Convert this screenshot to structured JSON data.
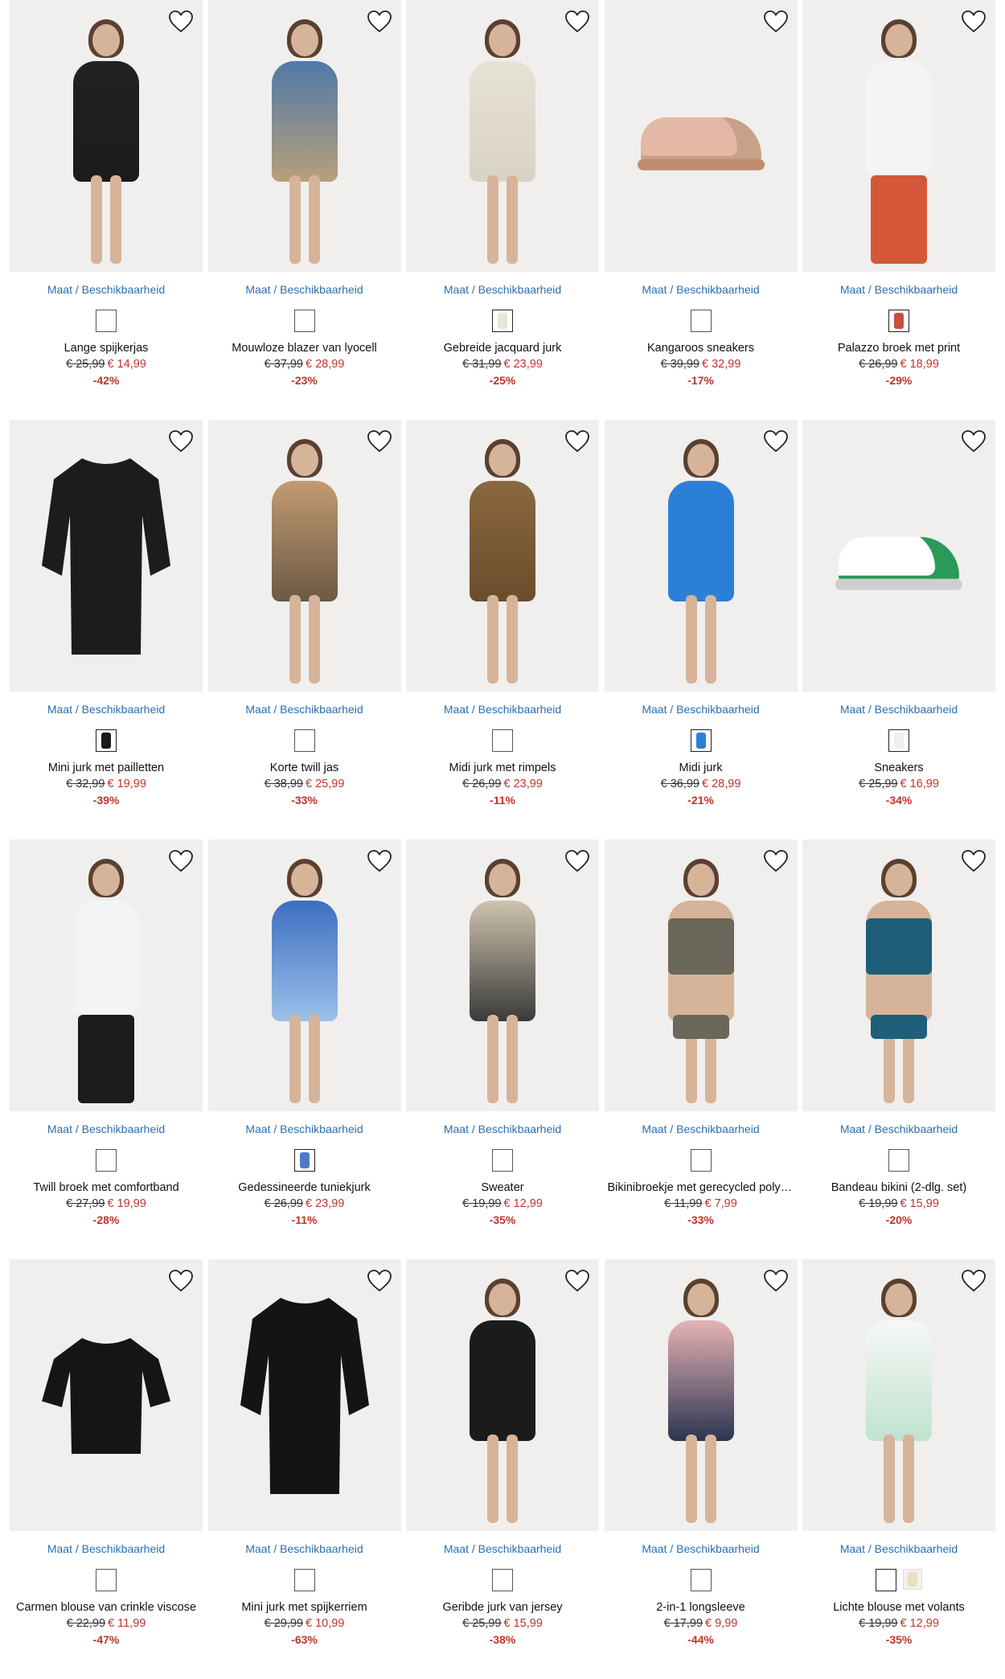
{
  "common": {
    "size_link": "Maat / Beschikbaarheid"
  },
  "colors": {
    "price_new": "#c0342c",
    "link": "#2a6fb0",
    "image_bg": "#f0efed"
  },
  "products": [
    {
      "name": "Lange spijkerjas",
      "old_price": "€ 25,99",
      "new_price": "€ 14,99",
      "discount": "-42%",
      "kind": "dress",
      "colors": [
        "#222222",
        "#1b1b1b"
      ],
      "swatches": [
        "plain"
      ]
    },
    {
      "name": "Mouwloze blazer van lyocell",
      "old_price": "€ 37,99",
      "new_price": "€ 28,99",
      "discount": "-23%",
      "kind": "dress",
      "colors": [
        "#4f79a8",
        "#b99f7a"
      ],
      "swatches": [
        "plain"
      ]
    },
    {
      "name": "Gebreide jacquard jurk",
      "old_price": "€ 31,99",
      "new_price": "€ 23,99",
      "discount": "-25%",
      "kind": "dress",
      "colors": [
        "#e6e2d6",
        "#d9d3c4"
      ],
      "swatches": [
        "#e8e4d8"
      ]
    },
    {
      "name": "Kangaroos sneakers",
      "old_price": "€ 39,99",
      "new_price": "€ 32,99",
      "discount": "-17%",
      "kind": "shoe",
      "colors": [
        "#e3b9a6",
        "#c9a08a"
      ],
      "swatches": [
        "plain"
      ]
    },
    {
      "name": "Palazzo broek met print",
      "old_price": "€ 26,99",
      "new_price": "€ 18,99",
      "discount": "-29%",
      "kind": "pants",
      "colors": [
        "#d4573a",
        "#3f6e5a"
      ],
      "swatches": [
        "#c8503a"
      ]
    },
    {
      "name": "Mini jurk met pailletten",
      "old_price": "€ 32,99",
      "new_price": "€ 19,99",
      "discount": "-39%",
      "kind": "flat-dress",
      "colors": [
        "#1c1c1c",
        "#111111"
      ],
      "swatches": [
        "#1a1a1a"
      ]
    },
    {
      "name": "Korte twill jas",
      "old_price": "€ 38,99",
      "new_price": "€ 25,99",
      "discount": "-33%",
      "kind": "dress",
      "colors": [
        "#c39a72",
        "#6b5a45"
      ],
      "swatches": [
        "plain"
      ]
    },
    {
      "name": "Midi jurk met rimpels",
      "old_price": "€ 26,99",
      "new_price": "€ 23,99",
      "discount": "-11%",
      "kind": "dress",
      "colors": [
        "#8a6840",
        "#6b4d2c"
      ],
      "swatches": [
        "plain"
      ]
    },
    {
      "name": "Midi jurk",
      "old_price": "€ 36,99",
      "new_price": "€ 28,99",
      "discount": "-21%",
      "kind": "dress",
      "colors": [
        "#2c7fd8",
        "#2c7fd8"
      ],
      "swatches": [
        "#2c7fd8"
      ]
    },
    {
      "name": "Sneakers",
      "old_price": "€ 25,99",
      "new_price": "€ 16,99",
      "discount": "-34%",
      "kind": "shoe",
      "colors": [
        "#ffffff",
        "#2a9a5a"
      ],
      "swatches": [
        "#eeeeee"
      ]
    },
    {
      "name": "Twill broek met comfortband",
      "old_price": "€ 27,99",
      "new_price": "€ 19,99",
      "discount": "-28%",
      "kind": "pants",
      "colors": [
        "#1c1c1c",
        "#1c1c1c"
      ],
      "swatches": [
        "plain"
      ]
    },
    {
      "name": "Gedessineerde tuniekjurk",
      "old_price": "€ 26,99",
      "new_price": "€ 23,99",
      "discount": "-11%",
      "kind": "dress",
      "colors": [
        "#3d6fc2",
        "#9cc0e8"
      ],
      "swatches": [
        "#4d7bc6"
      ]
    },
    {
      "name": "Sweater",
      "old_price": "€ 19,99",
      "new_price": "€ 12,99",
      "discount": "-35%",
      "kind": "dress",
      "colors": [
        "#cfc3ae",
        "#3a3a3a"
      ],
      "swatches": [
        "plain"
      ]
    },
    {
      "name": "Bikinibroekje met gerecycled polya…",
      "old_price": "€ 11,99",
      "new_price": "€ 7,99",
      "discount": "-33%",
      "kind": "bikini",
      "colors": [
        "#6b675a",
        "#6b675a"
      ],
      "swatches": [
        "plain"
      ]
    },
    {
      "name": "Bandeau bikini (2-dlg. set)",
      "old_price": "€ 19,99",
      "new_price": "€ 15,99",
      "discount": "-20%",
      "kind": "bikini",
      "colors": [
        "#1f5f7a",
        "#1f5f7a"
      ],
      "swatches": [
        "plain"
      ]
    },
    {
      "name": "Carmen blouse van crinkle viscose",
      "old_price": "€ 22,99",
      "new_price": "€ 11,99",
      "discount": "-47%",
      "kind": "flat-top",
      "colors": [
        "#151515",
        "#151515"
      ],
      "swatches": [
        "plain"
      ]
    },
    {
      "name": "Mini jurk met spijkerriem",
      "old_price": "€ 29,99",
      "new_price": "€ 10,99",
      "discount": "-63%",
      "kind": "flat-dress",
      "colors": [
        "#141414",
        "#141414"
      ],
      "swatches": [
        "plain"
      ]
    },
    {
      "name": "Geribde jurk van jersey",
      "old_price": "€ 25,99",
      "new_price": "€ 15,99",
      "discount": "-38%",
      "kind": "dress",
      "colors": [
        "#1b1b1b",
        "#1b1b1b"
      ],
      "swatches": [
        "plain"
      ]
    },
    {
      "name": "2-in-1 longsleeve",
      "old_price": "€ 17,99",
      "new_price": "€ 9,99",
      "discount": "-44%",
      "kind": "dress",
      "colors": [
        "#e6b3b5",
        "#2b3550"
      ],
      "swatches": [
        "plain"
      ]
    },
    {
      "name": "Lichte blouse met volants",
      "old_price": "€ 19,99",
      "new_price": "€ 12,99",
      "discount": "-35%",
      "kind": "dress",
      "colors": [
        "#f7f7f7",
        "#bfe3cf"
      ],
      "swatches": [
        "#ffffff",
        "#e9dfc2"
      ]
    }
  ]
}
